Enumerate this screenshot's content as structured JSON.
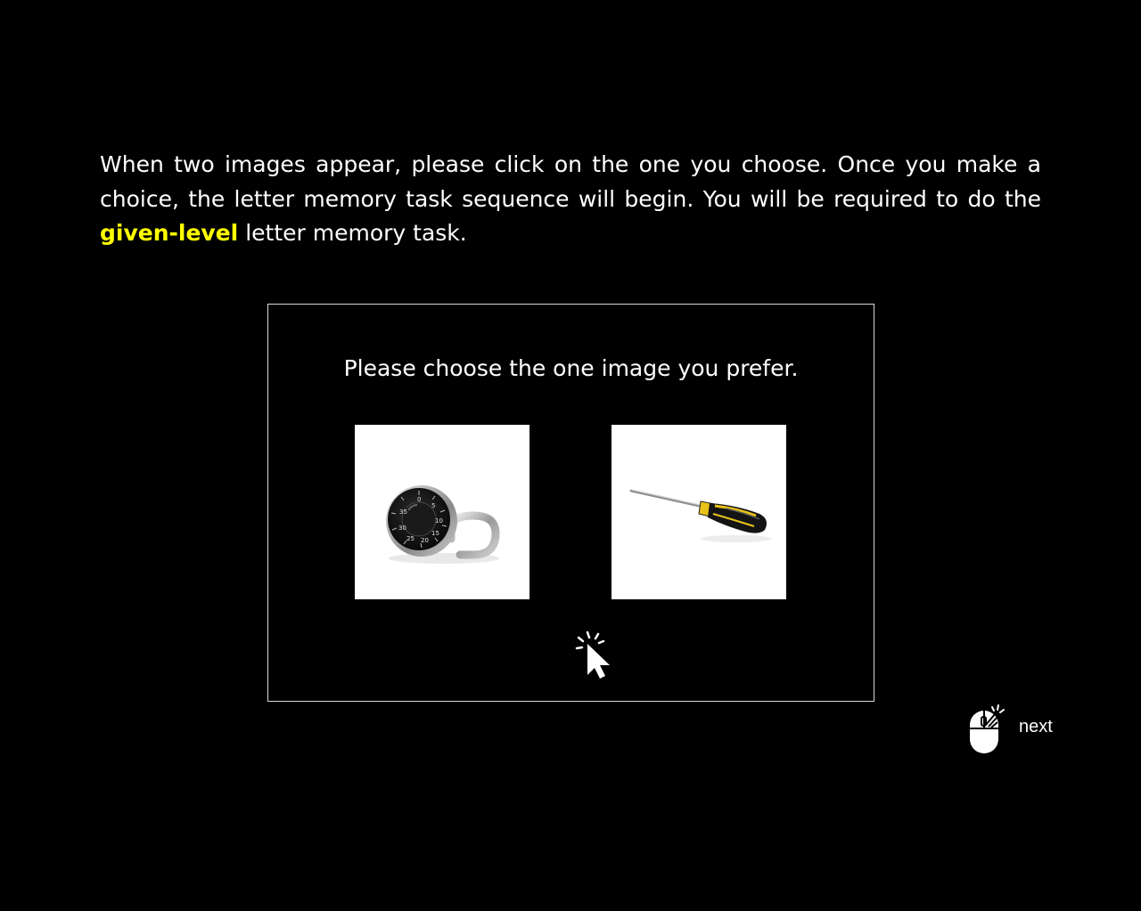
{
  "instructions": {
    "part1": "When two images appear, please click on the one you choose. Once you make a choice, the letter memory task sequence will begin. You will be required to do the ",
    "highlight": "given-level",
    "part2": " letter memory task.",
    "highlight_color": "#ffff00"
  },
  "example": {
    "prompt": "Please choose the one image you prefer.",
    "choices": [
      {
        "icon": "combination-padlock-icon"
      },
      {
        "icon": "screwdriver-icon"
      }
    ],
    "pointer_icon": "click-pointer-icon"
  },
  "navigation": {
    "icon": "mouse-click-icon",
    "next_label": "next"
  }
}
